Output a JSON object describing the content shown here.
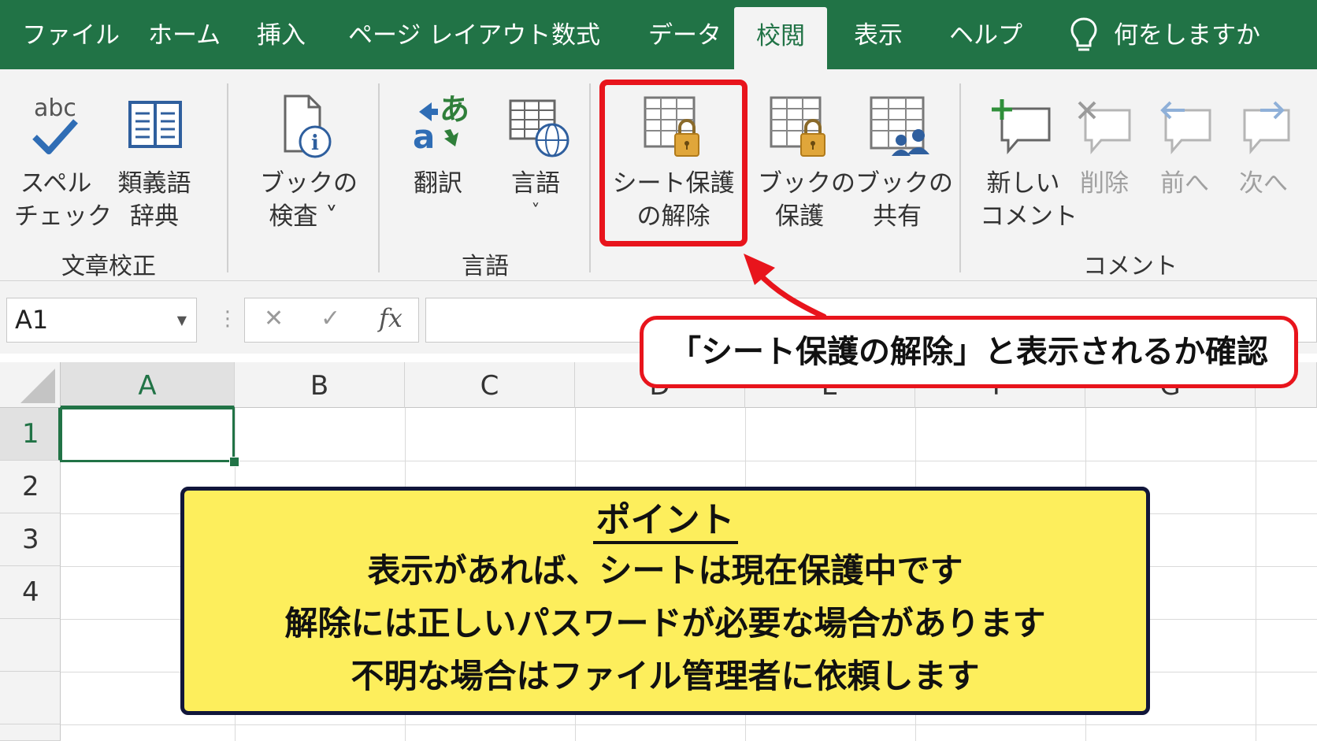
{
  "tabs": [
    {
      "label": "ファイル"
    },
    {
      "label": "ホーム"
    },
    {
      "label": "挿入"
    },
    {
      "label": "ページ レイアウト"
    },
    {
      "label": "数式"
    },
    {
      "label": "データ"
    },
    {
      "label": "校閲",
      "active": true
    },
    {
      "label": "表示"
    },
    {
      "label": "ヘルプ"
    }
  ],
  "tell_me": "何をしますか",
  "ribbon": {
    "proofing": {
      "spell_line1": "スペル",
      "spell_line2": "チェック",
      "spell_abc": "abc",
      "thesaurus_line1": "類義語",
      "thesaurus_line2": "辞典",
      "group_label": "文章校正"
    },
    "insights": {
      "check_line1": "ブックの",
      "check_line2": "検査 ˅"
    },
    "language": {
      "translate_label": "翻訳",
      "translate_glyph_a": "あ",
      "translate_glyph_b": "a",
      "language_label": "言語",
      "language_dropdown": "˅",
      "group_label": "言語"
    },
    "protect": {
      "unprotect_line1": "シート保護",
      "unprotect_line2": "の解除",
      "protect_book_line1": "ブックの",
      "protect_book_line2": "保護",
      "share_book_line1": "ブックの",
      "share_book_line2": "共有"
    },
    "comments": {
      "new_line1": "新しい",
      "new_line2": "コメント",
      "delete_label": "削除",
      "prev_label": "前へ",
      "next_label": "次へ",
      "group_label": "コメント"
    }
  },
  "formula_bar": {
    "name_box": "A1",
    "cancel": "✕",
    "enter": "✓",
    "fx": "fx",
    "content": ""
  },
  "sheet": {
    "columns": [
      "A",
      "B",
      "C",
      "D",
      "E",
      "F",
      "G"
    ],
    "rows": [
      "1",
      "2",
      "3",
      "4"
    ]
  },
  "callout_text": "「シート保護の解除」と表示されるか確認",
  "point_box": {
    "title": "ポイント",
    "lines": [
      "表示があれば、シートは現在保護中です",
      "解除には正しいパスワードが必要な場合があります",
      "不明な場合はファイル管理者に依頼します"
    ]
  },
  "colors": {
    "excel_green": "#217346",
    "highlight_red": "#e8141c",
    "point_yellow": "#fdee5c",
    "point_border": "#11163a"
  }
}
